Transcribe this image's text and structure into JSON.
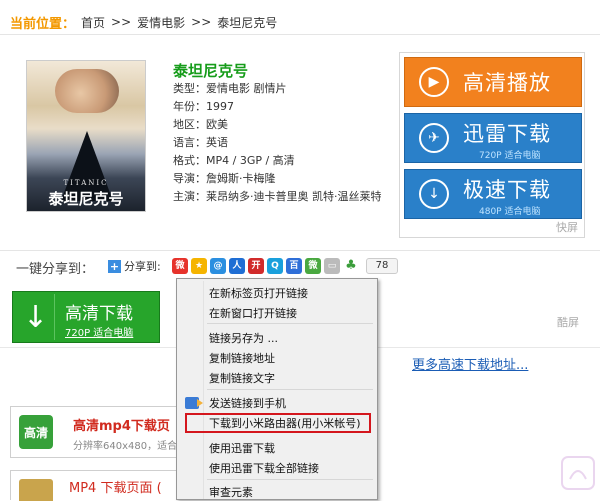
{
  "breadcrumb": {
    "label": "当前位置：",
    "items": [
      "首页",
      "爱情电影",
      "泰坦尼克号"
    ],
    "separator": ">>"
  },
  "poster": {
    "caption_small": "TITANIC",
    "caption_big": "泰坦尼克号"
  },
  "movie": {
    "title": "泰坦尼克号",
    "fields": [
      "类型：爱情电影 剧情片",
      "年份：1997",
      "地区：欧美",
      "语言：英语",
      "格式：MP4 / 3GP / 高清",
      "导演：詹姆斯·卡梅隆",
      "主演：莱昂纳多·迪卡普里奥 凯特·温丝莱特"
    ]
  },
  "buttons": {
    "play": {
      "label": "高清播放"
    },
    "xunlei": {
      "label": "迅雷下载",
      "sub": "720P 适合电脑"
    },
    "fast": {
      "label": "极速下载",
      "sub": "480P 适合电脑"
    },
    "kuaiping": "快屏"
  },
  "share": {
    "label": "一键分享到：",
    "share_to": "分享到:",
    "count": "78"
  },
  "download_hd": {
    "title": "高清下载",
    "sub": "720P 适合电脑"
  },
  "kuaiping2": "酷屏",
  "more_link": "更多高速下载地址...",
  "mp4": {
    "badge": "高清",
    "title": "高清mp4下载页",
    "sub": "分辨率640x480，适合",
    "title2": "MP4 下载页面 ("
  },
  "context_menu": {
    "items": [
      "在新标签页打开链接",
      "在新窗口打开链接",
      "链接另存为 ...",
      "复制链接地址",
      "复制链接文字",
      "发送链接到手机",
      "下载到小米路由器(用小米帐号)",
      "使用迅雷下载",
      "使用迅雷下载全部链接",
      "审查元素"
    ]
  },
  "colors": {
    "accent_green": "#169c1a",
    "orange": "#f2811e",
    "blue": "#2a80c9",
    "highlight_red": "#d4161d"
  }
}
